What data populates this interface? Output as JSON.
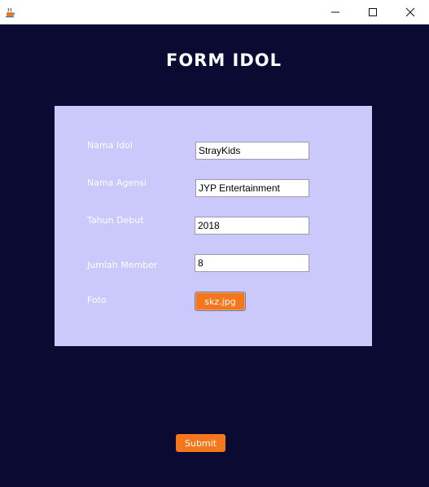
{
  "window": {
    "icon": "java-cup-icon",
    "controls": {
      "minimize": "—",
      "maximize": "☐",
      "close": "✕"
    }
  },
  "form": {
    "title": "FORM IDOL",
    "fields": {
      "nama_idol": {
        "label": "Nama Idol",
        "value": "StrayKids"
      },
      "nama_agensi": {
        "label": "Nama Agensi",
        "value": "JYP Entertainment"
      },
      "tahun_debut": {
        "label": "Tahun Debut",
        "value": "2018"
      },
      "jumlah_member": {
        "label": "Jumlah Member",
        "value": "8"
      },
      "foto": {
        "label": "Foto",
        "button_label": "skz.jpg"
      }
    },
    "submit_label": "Submit"
  },
  "colors": {
    "background": "#0a0a33",
    "panel": "#cbc8fb",
    "button": "#f5771d",
    "label_text": "#ffffff"
  }
}
